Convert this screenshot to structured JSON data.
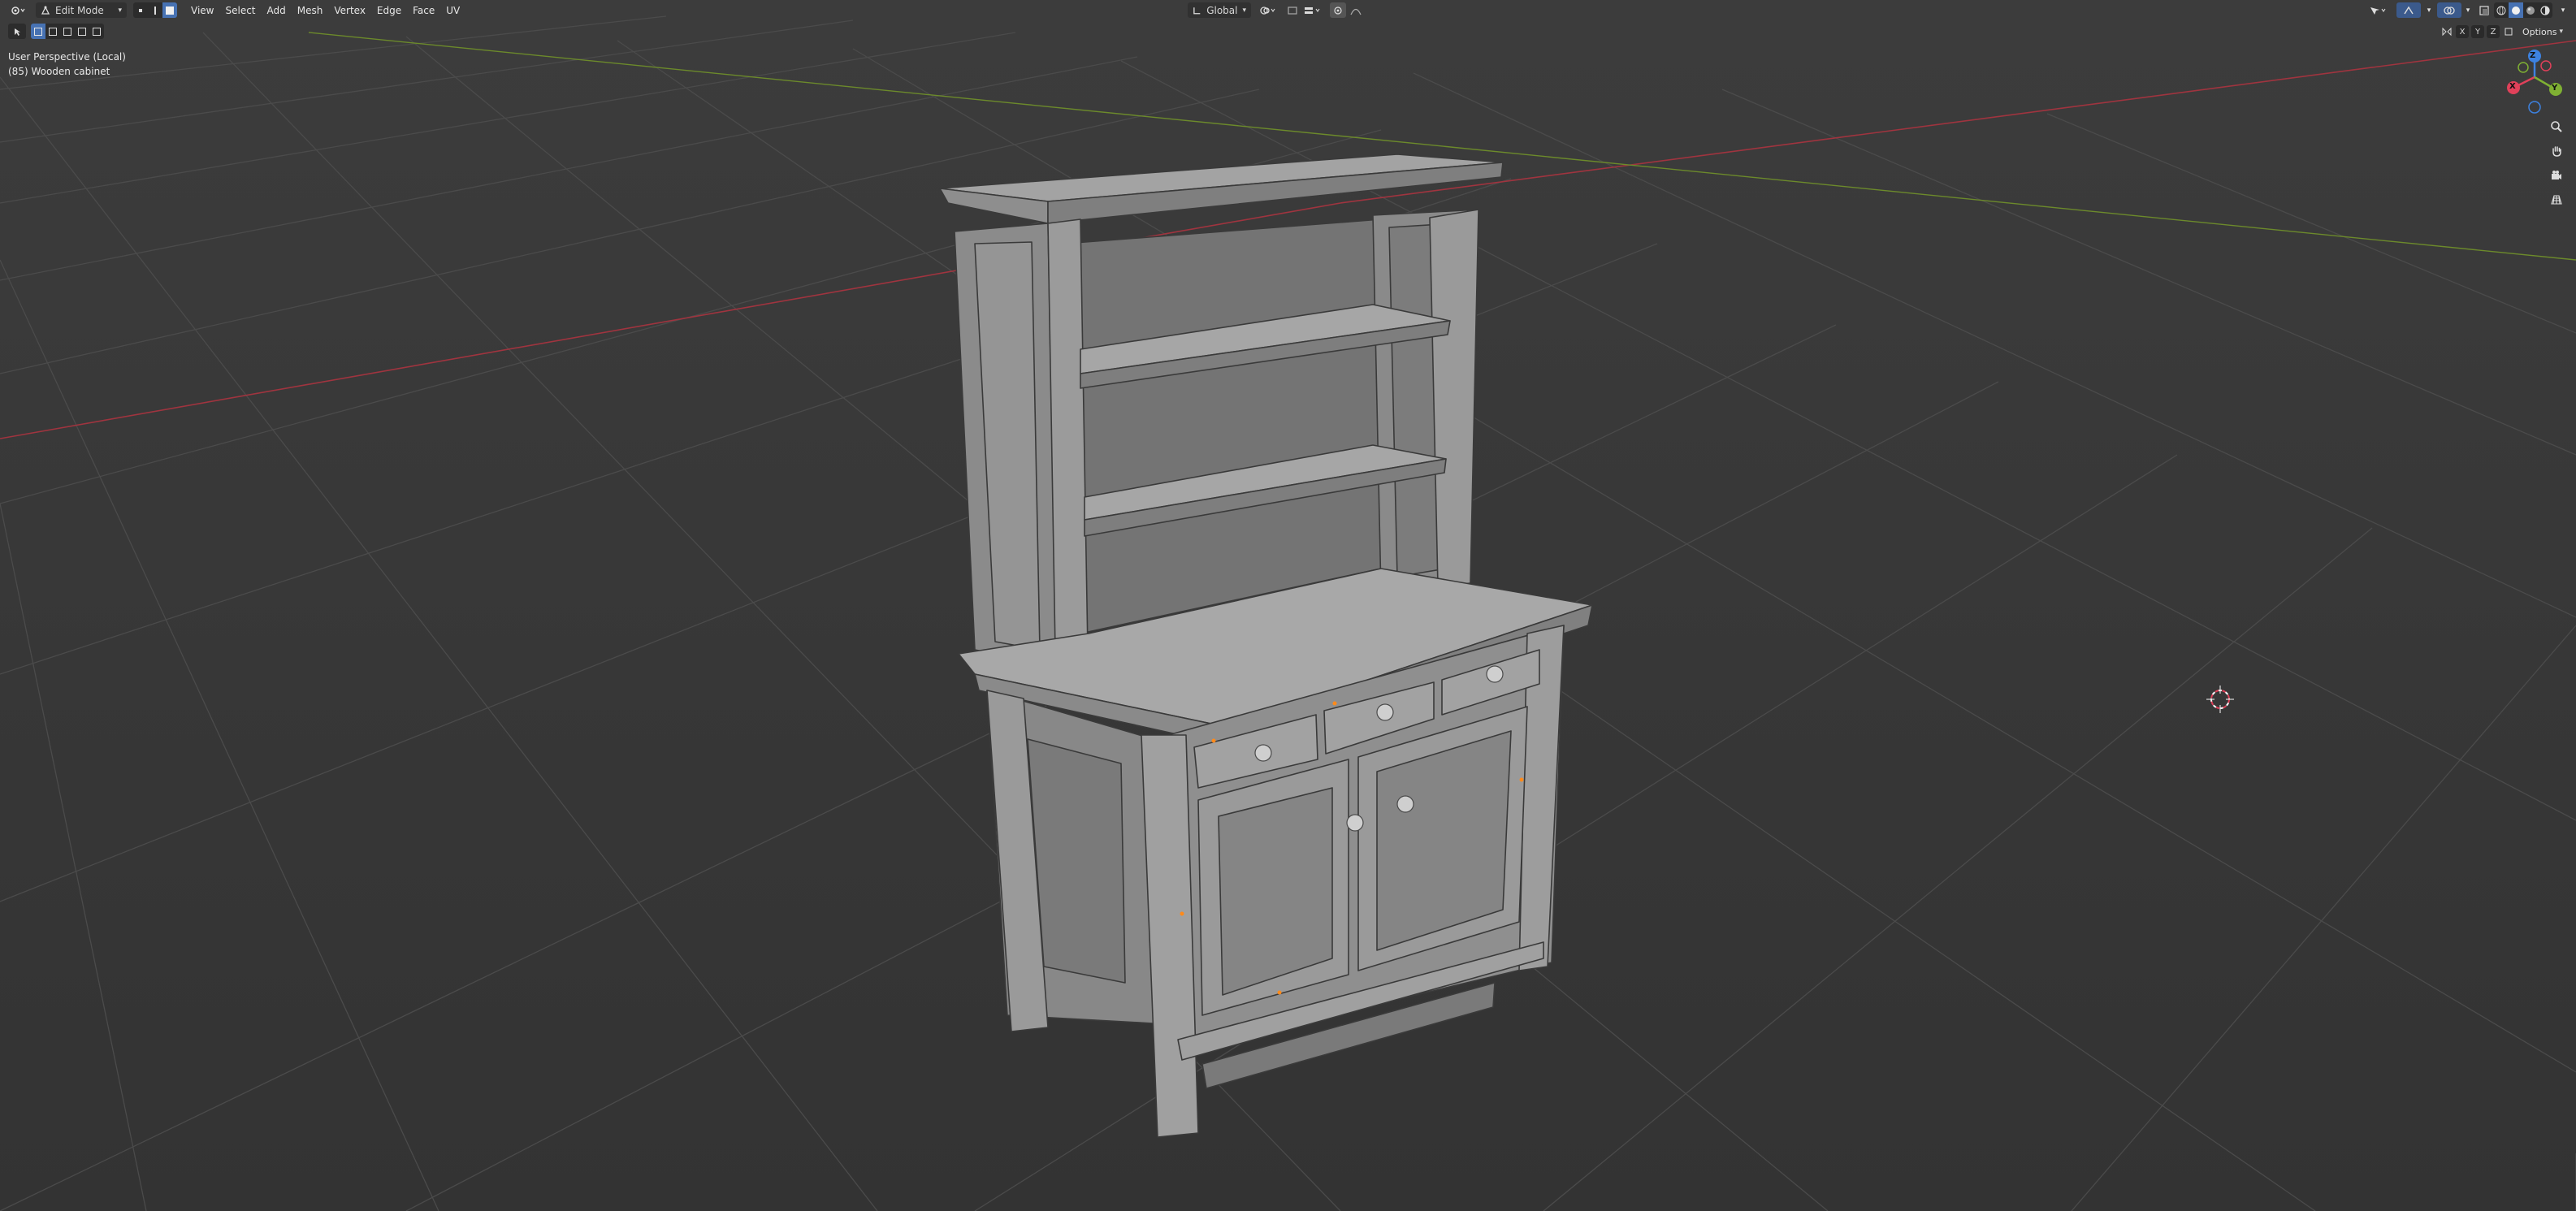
{
  "header": {
    "mode_label": "Edit Mode",
    "menus": [
      "View",
      "Select",
      "Add",
      "Mesh",
      "Vertex",
      "Edge",
      "Face",
      "UV"
    ],
    "transform_orientation": "Global",
    "options_label": "Options"
  },
  "mirror_axes": [
    "X",
    "Y",
    "Z"
  ],
  "viewport": {
    "perspective_label": "User Perspective (Local)",
    "object_label": "(85) Wooden cabinet"
  },
  "gizmo": {
    "x_color": "#e0415a",
    "y_color": "#7fb033",
    "z_color": "#3d82e1",
    "labels": [
      "X",
      "Y",
      "Z"
    ]
  },
  "icons": {
    "editor_type": "editor-type-icon",
    "select_vertex": "vertex-select-icon",
    "select_edge": "edge-select-icon",
    "select_face": "face-select-icon",
    "zoom": "magnifier-icon",
    "pan": "hand-icon",
    "camera": "camera-icon",
    "ortho": "grid-ortho-icon",
    "cursor_3d": "3d-cursor-icon"
  },
  "colors": {
    "background": "#393939",
    "grid": "#4a4a4a",
    "x_axis_line": "#a0343f",
    "y_axis_line": "#6c8a2b",
    "mesh_fill": "#8a8a8a",
    "accent": "#4772b3"
  }
}
